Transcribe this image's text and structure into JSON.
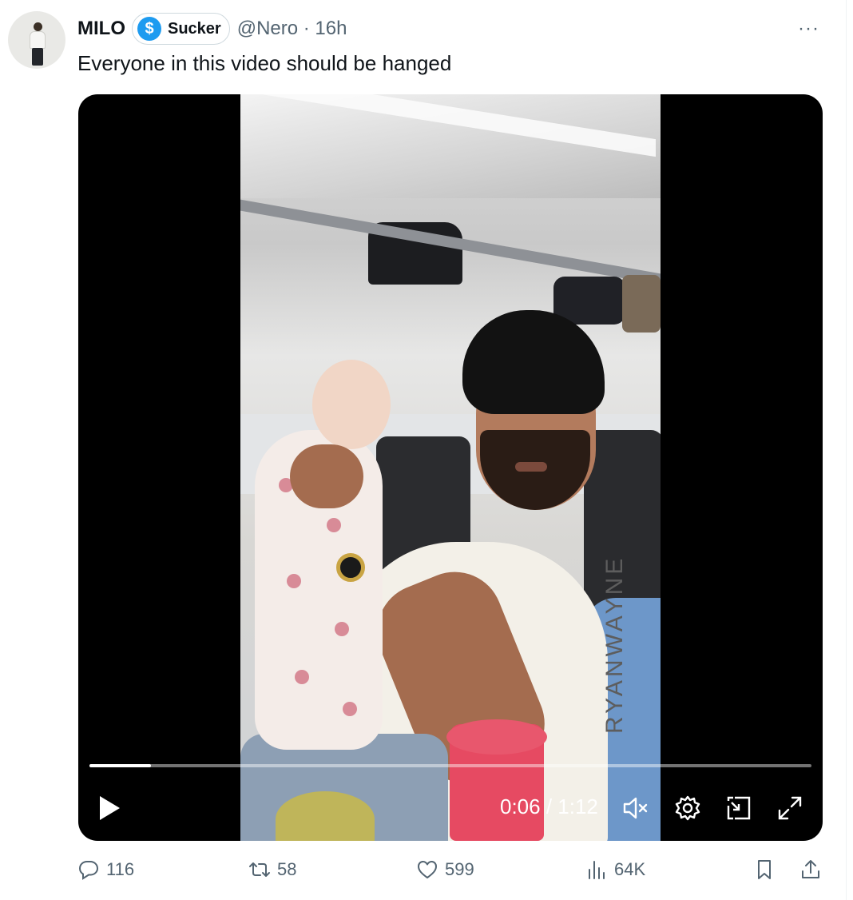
{
  "author": {
    "name": "MILO",
    "badge_label": "Sucker",
    "badge_icon": "$",
    "handle_time": "@Nero · 16h"
  },
  "tweet": {
    "text": "Everyone in this video should be hanged"
  },
  "video": {
    "watermark": "RYANWAYNE",
    "time_display": "0:06 / 1:12",
    "progress": 0.085
  },
  "actions": {
    "replies": "116",
    "reposts": "58",
    "likes": "599",
    "views": "64K"
  },
  "colors": {
    "accent": "#1d9bf0",
    "secondary_text": "#536471",
    "primary_text": "#0f1419"
  }
}
